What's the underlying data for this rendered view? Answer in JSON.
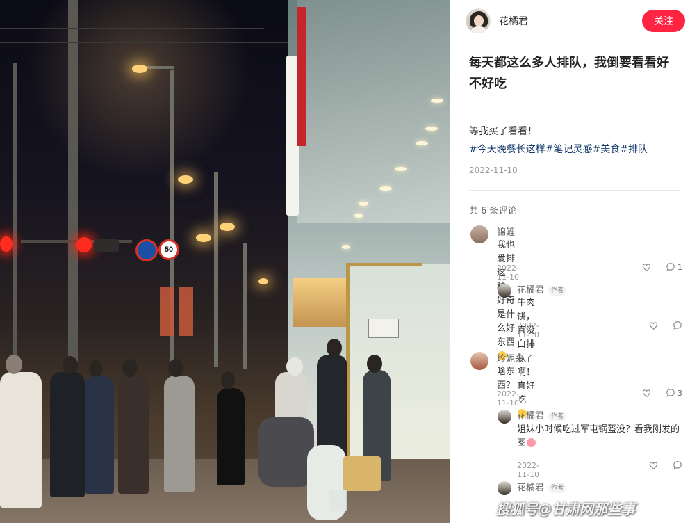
{
  "author": {
    "name": "花橘君",
    "follow_label": "关注"
  },
  "note": {
    "title": "每天都这么多人排队，我倒要看看好不好吃",
    "body": "等我买了看看！",
    "tags": [
      "#今天晚餐长这样",
      "#笔记灵感",
      "#美食",
      "#排队"
    ],
    "date": "2022-11-10"
  },
  "comments_header": "共 6 条评论",
  "author_badge": "作者",
  "comments": [
    {
      "name": "锦鲤",
      "text": "我也爱排这种，好奇是什么好东西",
      "date": "2022-11-10",
      "reply_count": "1",
      "replies": [
        {
          "name": "花橘君",
          "text": "牛肉饼，真没白排队啊！真好吃",
          "date": "2022-11-10"
        }
      ]
    },
    {
      "name": "珍妮来了",
      "text": "啥东西？",
      "date": "2022-11-10",
      "reply_count": "3",
      "replies": [
        {
          "name": "花橘君",
          "text_line1": "姐妹小时候吃过军屯锅盔没？看我刚发的",
          "text_line2": "图",
          "date": "2022-11-10"
        },
        {
          "name": "花橘君"
        }
      ]
    }
  ],
  "photo": {
    "speed_sign": "50"
  },
  "icons": {
    "like": "heart-icon",
    "comment": "comment-bubble-icon",
    "emoji_laugh": "laughing-emoji-icon",
    "emoji_yum": "yum-emoji-icon",
    "emoji_pig": "pig-emoji-icon"
  },
  "colors": {
    "accent": "#ff2442",
    "tag": "#13386c",
    "meta": "#999999"
  },
  "watermark": "搜狐号@甘肃网那些事"
}
